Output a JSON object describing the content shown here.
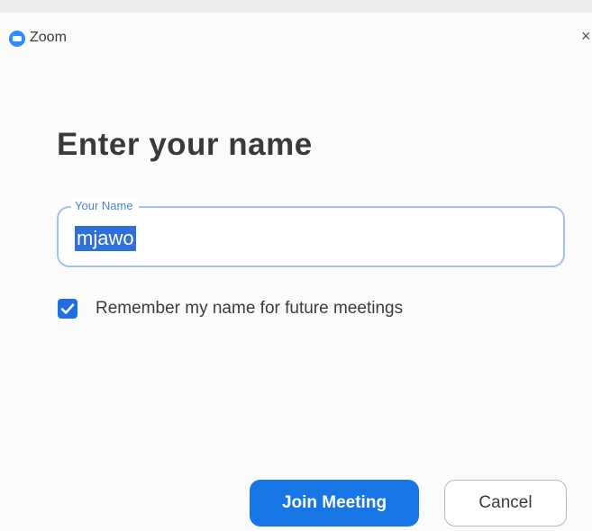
{
  "window": {
    "app_title": "Zoom",
    "close_glyph": "×",
    "icon": "zoom-logo-icon"
  },
  "dialog": {
    "heading": "Enter your name",
    "name_field": {
      "label": "Your Name",
      "value": "mjawo",
      "selected": true
    },
    "remember_checkbox": {
      "label": "Remember my name for future meetings",
      "checked": true
    },
    "join_button_label": "Join Meeting",
    "cancel_button_label": "Cancel"
  },
  "colors": {
    "accent": "#1676e6",
    "field_border": "#9fc3ef",
    "selection": "#2f6fd8"
  }
}
